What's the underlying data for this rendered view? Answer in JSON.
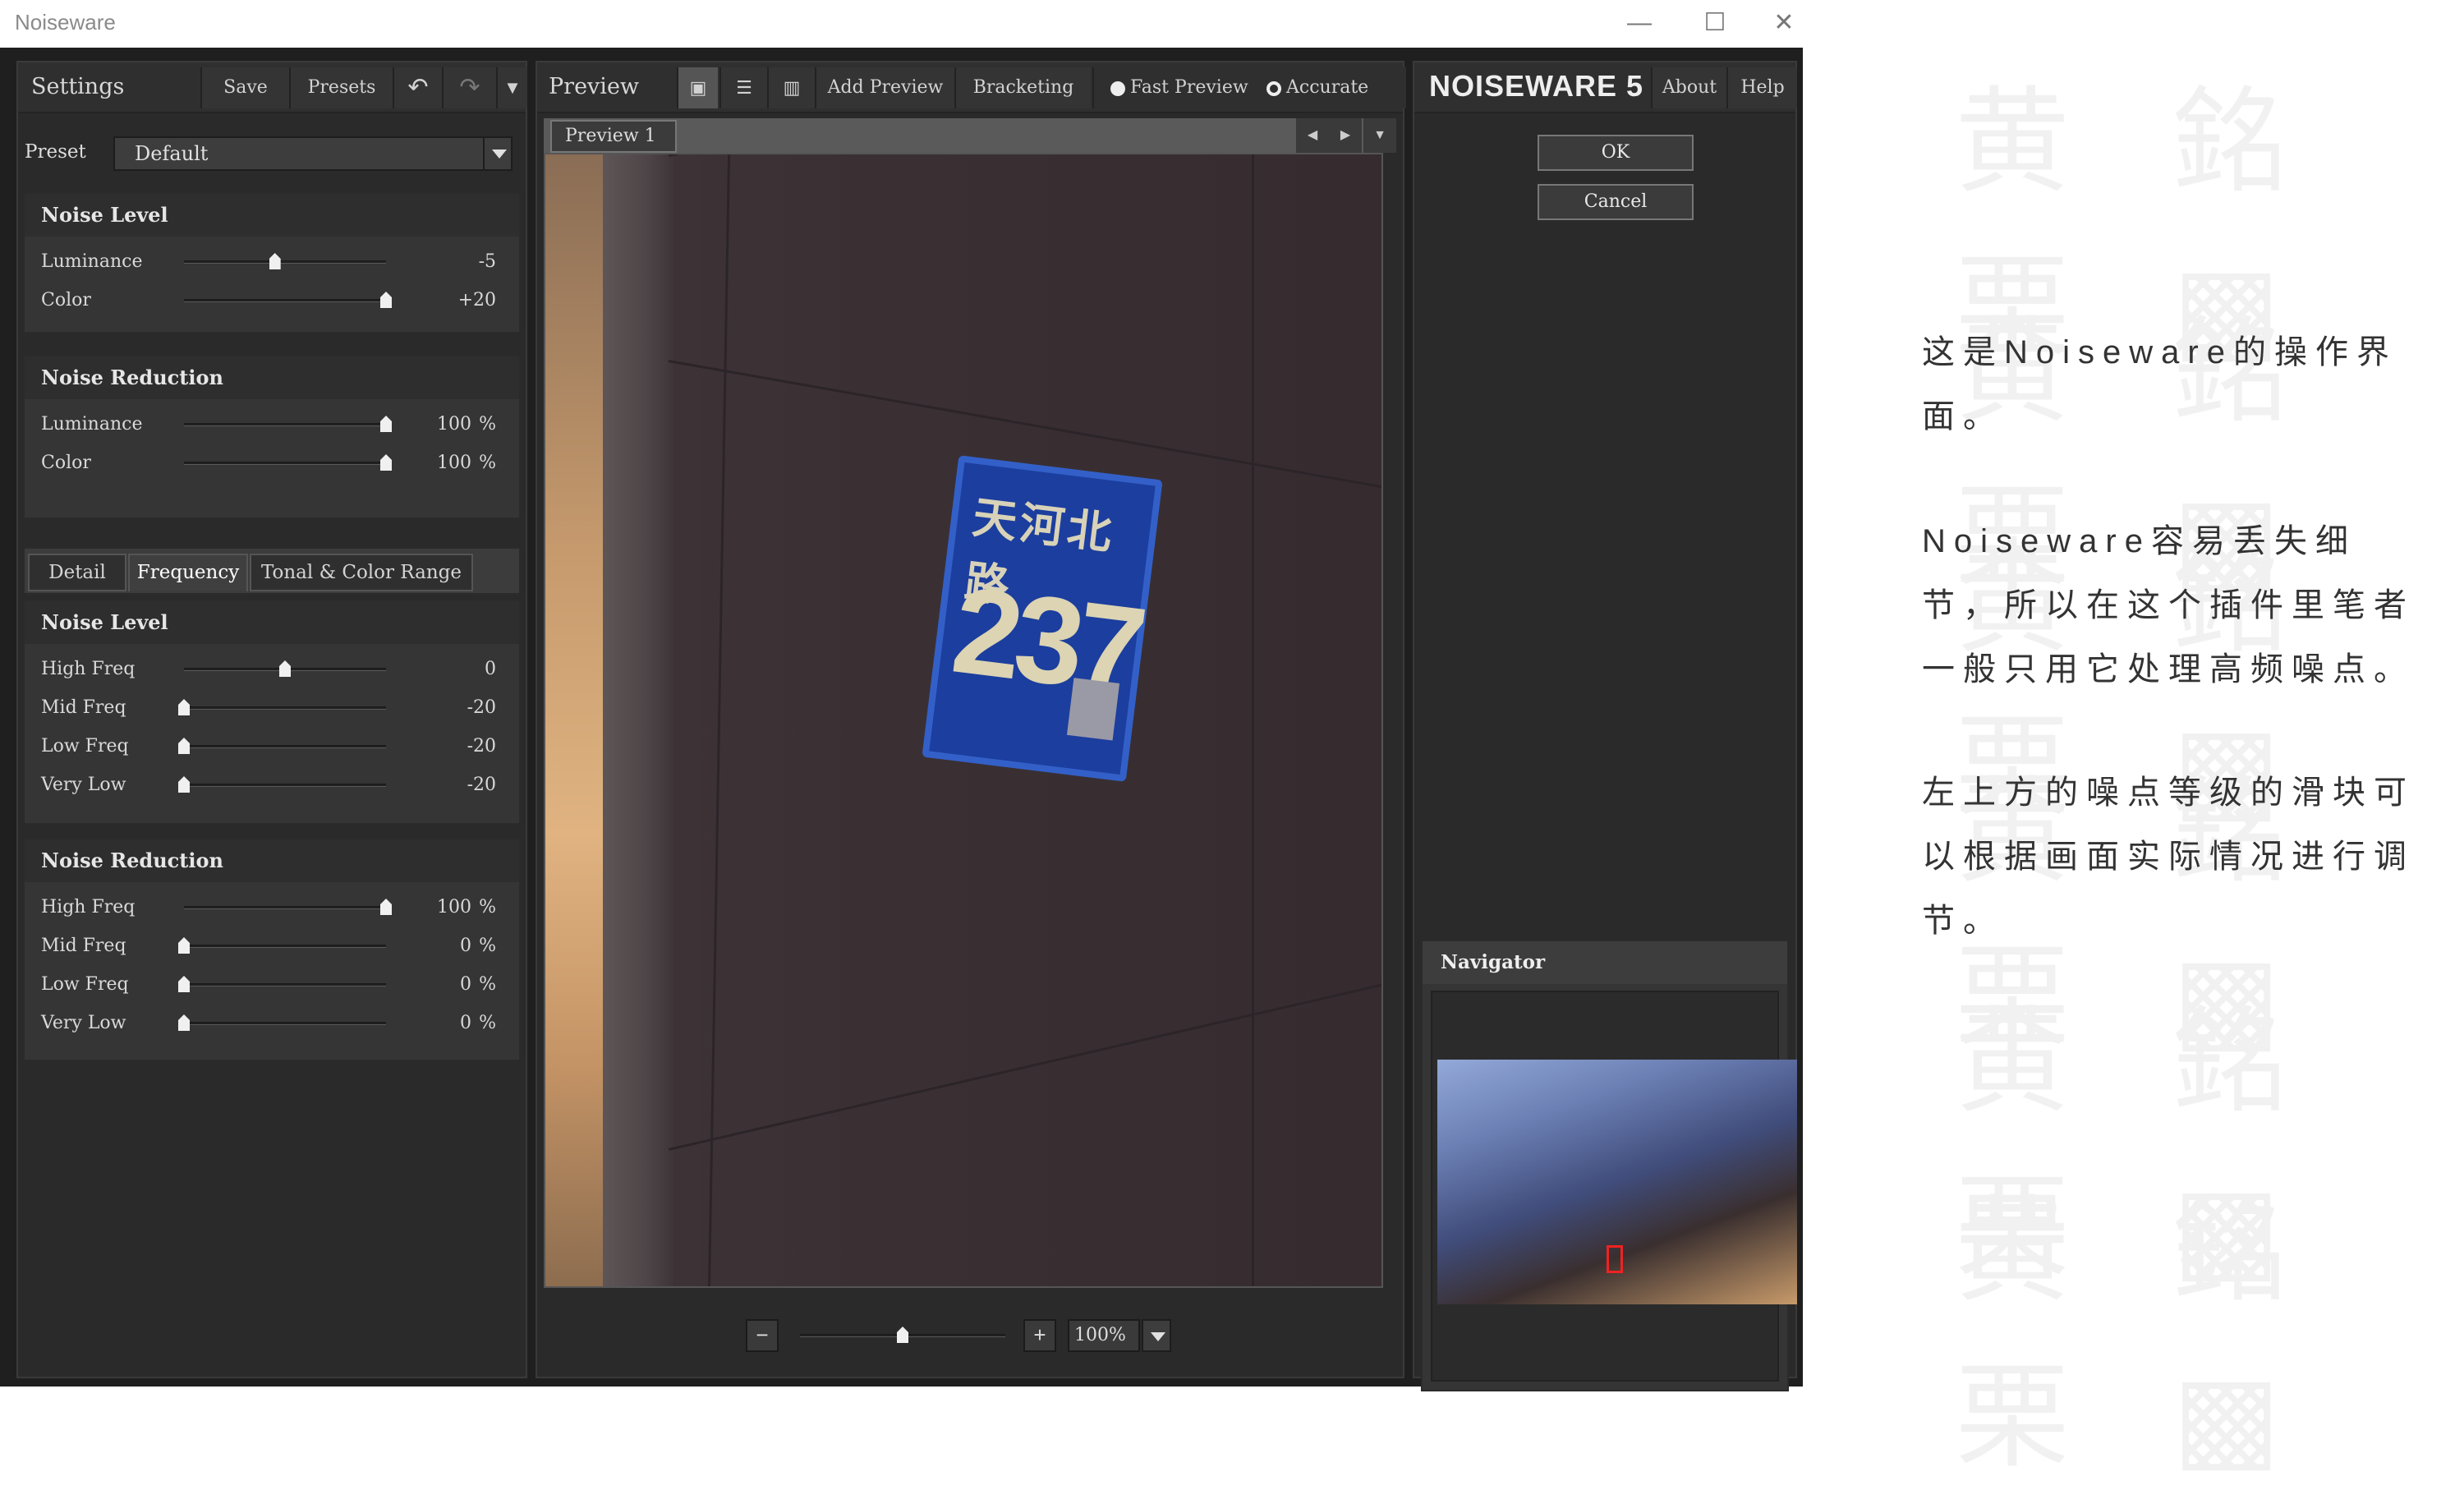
{
  "window": {
    "title": "Noiseware"
  },
  "settings": {
    "title": "Settings",
    "save": "Save",
    "presets": "Presets",
    "preset_label": "Preset",
    "preset_value": "Default",
    "noise_level": {
      "title": "Noise Level",
      "rows": [
        {
          "label": "Luminance",
          "value": "-5",
          "pos": 0.45
        },
        {
          "label": "Color",
          "value": "+20",
          "pos": 1.0
        }
      ]
    },
    "noise_reduction": {
      "title": "Noise Reduction",
      "rows": [
        {
          "label": "Luminance",
          "value": "100",
          "unit": "%",
          "pos": 1.0
        },
        {
          "label": "Color",
          "value": "100",
          "unit": "%",
          "pos": 1.0
        }
      ]
    },
    "tabs": [
      "Detail",
      "Frequency",
      "Tonal & Color Range"
    ],
    "freq_noise_level": {
      "title": "Noise Level",
      "rows": [
        {
          "label": "High Freq",
          "value": "0",
          "pos": 0.5
        },
        {
          "label": "Mid Freq",
          "value": "-20",
          "pos": 0.0
        },
        {
          "label": "Low Freq",
          "value": "-20",
          "pos": 0.0
        },
        {
          "label": "Very Low",
          "value": "-20",
          "pos": 0.0
        }
      ]
    },
    "freq_noise_reduction": {
      "title": "Noise Reduction",
      "rows": [
        {
          "label": "High Freq",
          "value": "100",
          "unit": "%",
          "pos": 1.0
        },
        {
          "label": "Mid Freq",
          "value": "0",
          "unit": "%",
          "pos": 0.0
        },
        {
          "label": "Low Freq",
          "value": "0",
          "unit": "%",
          "pos": 0.0
        },
        {
          "label": "Very Low",
          "value": "0",
          "unit": "%",
          "pos": 0.0
        }
      ]
    }
  },
  "preview": {
    "title": "Preview",
    "add_preview": "Add Preview",
    "bracketing": "Bracketing",
    "fast_preview": "Fast Preview",
    "accurate": "Accurate",
    "tab": "Preview 1",
    "sign_text": "天河北路",
    "sign_number": "237",
    "zoom_minus": "−",
    "zoom_plus": "+",
    "zoom": "100%",
    "zoom_pos": 0.5
  },
  "right": {
    "brand": "NOISEWARE 5",
    "about": "About",
    "help": "Help",
    "ok": "OK",
    "cancel": "Cancel",
    "navigator": "Navigator"
  },
  "notes": [
    "这是Noiseware的操作界面。",
    "Noiseware容易丢失细节，所以在这个插件里笔者一般只用它处理高频噪点。",
    "左上方的噪点等级的滑块可以根据画面实际情况进行调节。"
  ]
}
